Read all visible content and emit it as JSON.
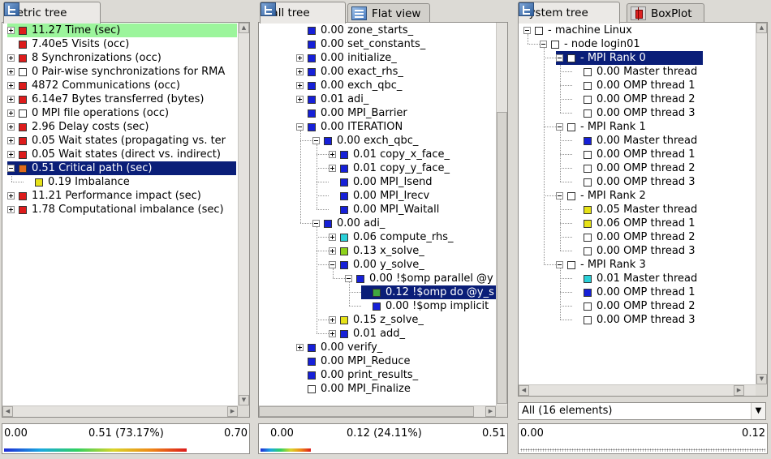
{
  "colors": {
    "red": "#dd1c1c",
    "blue": "#1620d8",
    "white": "#ffffff",
    "yellow": "#e6e218",
    "lime": "#8ed21c",
    "orange": "#e06a1c",
    "cyan": "#2ad0d8",
    "green_mid": "#40a840",
    "selection_green": "#9cf59c",
    "selection_blue": "#0a1e78"
  },
  "metric_pane": {
    "tab_label": "Metric tree",
    "tab_icon": "tree-icon",
    "rows": [
      {
        "label": "11.27 Time (sec)",
        "color": "red",
        "expander": "plus"
      },
      {
        "label": "7.40e5 Visits (occ)",
        "color": "red",
        "expander": "none"
      },
      {
        "label": "8 Synchronizations (occ)",
        "color": "red",
        "expander": "plus"
      },
      {
        "label": "0 Pair-wise synchronizations for RMA",
        "color": "white",
        "expander": "plus"
      },
      {
        "label": "4872 Communications (occ)",
        "color": "red",
        "expander": "plus"
      },
      {
        "label": "6.14e7 Bytes transferred (bytes)",
        "color": "red",
        "expander": "plus"
      },
      {
        "label": "0 MPI file operations (occ)",
        "color": "white",
        "expander": "plus"
      },
      {
        "label": "2.96 Delay costs (sec)",
        "color": "red",
        "expander": "plus"
      },
      {
        "label": "0.05 Wait states (propagating vs. ter",
        "color": "red",
        "expander": "plus"
      },
      {
        "label": "0.05 Wait states (direct vs. indirect)",
        "color": "red",
        "expander": "plus"
      },
      {
        "label": "0.51 Critical path (sec)",
        "color": "orange",
        "expander": "minus"
      },
      {
        "label": "0.19 Imbalance",
        "color": "yellow",
        "expander": "none"
      },
      {
        "label": "11.21 Performance impact (sec)",
        "color": "red",
        "expander": "plus"
      },
      {
        "label": "1.78 Computational imbalance (sec)",
        "color": "red",
        "expander": "plus"
      }
    ],
    "scale": {
      "min": "0.00",
      "mid": "0.51 (73.17%)",
      "max": "0.70"
    }
  },
  "call_pane": {
    "tabs": [
      {
        "label": "Call tree",
        "icon": "tree-icon"
      },
      {
        "label": "Flat view",
        "icon": "flat-view-icon"
      }
    ],
    "rows": [
      {
        "label": "0.00 zone_starts_",
        "color": "blue",
        "expander": "none"
      },
      {
        "label": "0.00 set_constants_",
        "color": "blue",
        "expander": "none"
      },
      {
        "label": "0.00 initialize_",
        "color": "blue",
        "expander": "plus"
      },
      {
        "label": "0.00 exact_rhs_",
        "color": "blue",
        "expander": "plus"
      },
      {
        "label": "0.00 exch_qbc_",
        "color": "blue",
        "expander": "plus"
      },
      {
        "label": "0.01 adi_",
        "color": "blue",
        "expander": "plus"
      },
      {
        "label": "0.00 MPI_Barrier",
        "color": "blue",
        "expander": "none"
      },
      {
        "label": "0.00 ITERATION",
        "color": "blue",
        "expander": "minus"
      },
      {
        "label": "0.00 exch_qbc_",
        "color": "blue",
        "expander": "minus"
      },
      {
        "label": "0.01 copy_x_face_",
        "color": "blue",
        "expander": "plus"
      },
      {
        "label": "0.01 copy_y_face_",
        "color": "blue",
        "expander": "plus"
      },
      {
        "label": "0.00 MPI_Isend",
        "color": "blue",
        "expander": "none"
      },
      {
        "label": "0.00 MPI_Irecv",
        "color": "blue",
        "expander": "none"
      },
      {
        "label": "0.00 MPI_Waitall",
        "color": "blue",
        "expander": "none"
      },
      {
        "label": "0.00 adi_",
        "color": "blue",
        "expander": "minus"
      },
      {
        "label": "0.06 compute_rhs_",
        "color": "cyan",
        "expander": "plus"
      },
      {
        "label": "0.13 x_solve_",
        "color": "lime",
        "expander": "plus"
      },
      {
        "label": "0.00 y_solve_",
        "color": "blue",
        "expander": "minus"
      },
      {
        "label": "0.00 !$omp parallel @y",
        "color": "blue",
        "expander": "minus"
      },
      {
        "label": "0.12 !$omp do @y_s",
        "color": "green_mid",
        "expander": "none"
      },
      {
        "label": "0.00 !$omp implicit",
        "color": "blue",
        "expander": "none"
      },
      {
        "label": "0.15 z_solve_",
        "color": "yellow",
        "expander": "plus"
      },
      {
        "label": "0.01 add_",
        "color": "blue",
        "expander": "plus"
      },
      {
        "label": "0.00 verify_",
        "color": "blue",
        "expander": "plus"
      },
      {
        "label": "0.00 MPI_Reduce",
        "color": "blue",
        "expander": "none"
      },
      {
        "label": "0.00 print_results_",
        "color": "blue",
        "expander": "none"
      },
      {
        "label": "0.00 MPI_Finalize",
        "color": "white",
        "expander": "none"
      }
    ],
    "scale": {
      "min": "0.00",
      "mid": "0.12 (24.11%)",
      "max": "0.51"
    }
  },
  "system_pane": {
    "tabs": [
      {
        "label": "System tree",
        "icon": "tree-icon"
      },
      {
        "label": "BoxPlot",
        "icon": "boxplot-icon"
      }
    ],
    "rows": [
      {
        "label": "- machine Linux",
        "color": "white",
        "expander": "minus"
      },
      {
        "label": "- node login01",
        "color": "white",
        "expander": "minus"
      },
      {
        "label": "- MPI Rank 0",
        "color": "white",
        "expander": "minus"
      },
      {
        "label": "0.00 Master thread",
        "color": "white",
        "expander": "none"
      },
      {
        "label": "0.00 OMP thread 1",
        "color": "white",
        "expander": "none"
      },
      {
        "label": "0.00 OMP thread 2",
        "color": "white",
        "expander": "none"
      },
      {
        "label": "0.00 OMP thread 3",
        "color": "white",
        "expander": "none"
      },
      {
        "label": "- MPI Rank 1",
        "color": "white",
        "expander": "minus"
      },
      {
        "label": "0.00 Master thread",
        "color": "blue",
        "expander": "none"
      },
      {
        "label": "0.00 OMP thread 1",
        "color": "white",
        "expander": "none"
      },
      {
        "label": "0.00 OMP thread 2",
        "color": "white",
        "expander": "none"
      },
      {
        "label": "0.00 OMP thread 3",
        "color": "white",
        "expander": "none"
      },
      {
        "label": "- MPI Rank 2",
        "color": "white",
        "expander": "minus"
      },
      {
        "label": "0.05 Master thread",
        "color": "yellow",
        "expander": "none"
      },
      {
        "label": "0.06 OMP thread 1",
        "color": "yellow",
        "expander": "none"
      },
      {
        "label": "0.00 OMP thread 2",
        "color": "white",
        "expander": "none"
      },
      {
        "label": "0.00 OMP thread 3",
        "color": "white",
        "expander": "none"
      },
      {
        "label": "- MPI Rank 3",
        "color": "white",
        "expander": "minus"
      },
      {
        "label": "0.01 Master thread",
        "color": "cyan",
        "expander": "none"
      },
      {
        "label": "0.00 OMP thread 1",
        "color": "blue",
        "expander": "none"
      },
      {
        "label": "0.00 OMP thread 2",
        "color": "white",
        "expander": "none"
      },
      {
        "label": "0.00 OMP thread 3",
        "color": "white",
        "expander": "none"
      }
    ],
    "filter_value": "All (16 elements)",
    "scale": {
      "min": "0.00",
      "max": "0.12"
    }
  }
}
